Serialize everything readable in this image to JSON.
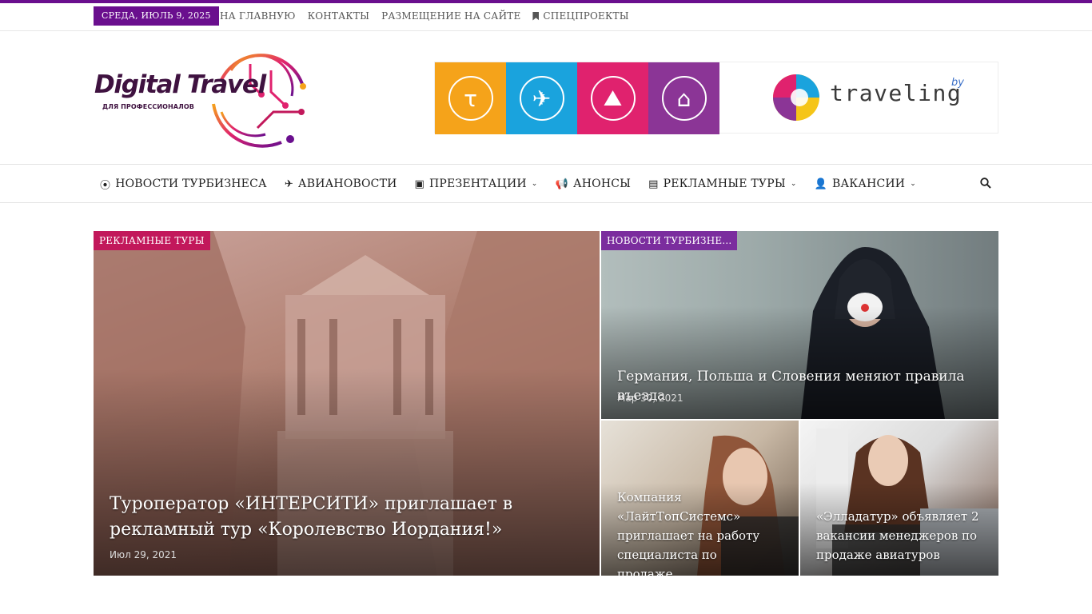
{
  "colors": {
    "accent": "#6a0f8e",
    "cat_tours": "#c2185b",
    "cat_news": "#7b2d9e"
  },
  "topbar": {
    "date": "СРЕДА, ИЮЛЬ 9, 2025",
    "links": [
      "НА ГЛАВНУЮ",
      "КОНТАКТЫ",
      "РАЗМЕЩЕНИЕ НА САЙТЕ",
      "СПЕЦПРОЕКТЫ"
    ]
  },
  "logo": {
    "title": "Digital Travel",
    "subtitle": "ДЛЯ ПРОФЕССИОНАЛОВ"
  },
  "banner": {
    "tiles": [
      {
        "glyph": "τ",
        "icon": "tau-icon",
        "color": "#f5a31a"
      },
      {
        "glyph": "✈",
        "icon": "plane-icon",
        "color": "#1aa3dd"
      },
      {
        "glyph": "⛰",
        "icon": "mountain-icon",
        "color": "#e0226e"
      },
      {
        "glyph": "⌂",
        "icon": "hotel-icon",
        "color": "#8b3596"
      }
    ],
    "brand": "traveling",
    "brand_suffix": "by"
  },
  "nav": {
    "items": [
      {
        "icon": "⦿",
        "label": "НОВОСТИ ТУРБИЗНЕСА",
        "dropdown": false
      },
      {
        "icon": "✈",
        "label": "АВИАНОВОСТИ",
        "dropdown": false
      },
      {
        "icon": "▣",
        "label": "ПРЕЗЕНТАЦИИ",
        "dropdown": true
      },
      {
        "icon": "📢",
        "label": "АНОНСЫ",
        "dropdown": false
      },
      {
        "icon": "▤",
        "label": "РЕКЛАМНЫЕ ТУРЫ",
        "dropdown": true
      },
      {
        "icon": "👤",
        "label": "ВАКАНСИИ",
        "dropdown": true
      }
    ],
    "chevron": "⌄"
  },
  "featured": {
    "main": {
      "category": "РЕКЛАМНЫЕ ТУРЫ",
      "title": "Туроператор «ИНТЕРСИТИ» приглашает в рекламный тур «Королевство Иордания!»",
      "date": "Июл 29, 2021"
    },
    "top_right": {
      "category": "НОВОСТИ ТУРБИЗНЕ...",
      "title": "Германия, Польша и Словения меняют правила въезда",
      "date": "Мар 30, 2021"
    },
    "bottom_left": {
      "title": "Компания «ЛайтТопСистемс» приглашает на работу специалиста по продаже..."
    },
    "bottom_right": {
      "title": "«Элладатур» объявляет 2 вакансии менеджеров по продаже авиатуров"
    }
  }
}
